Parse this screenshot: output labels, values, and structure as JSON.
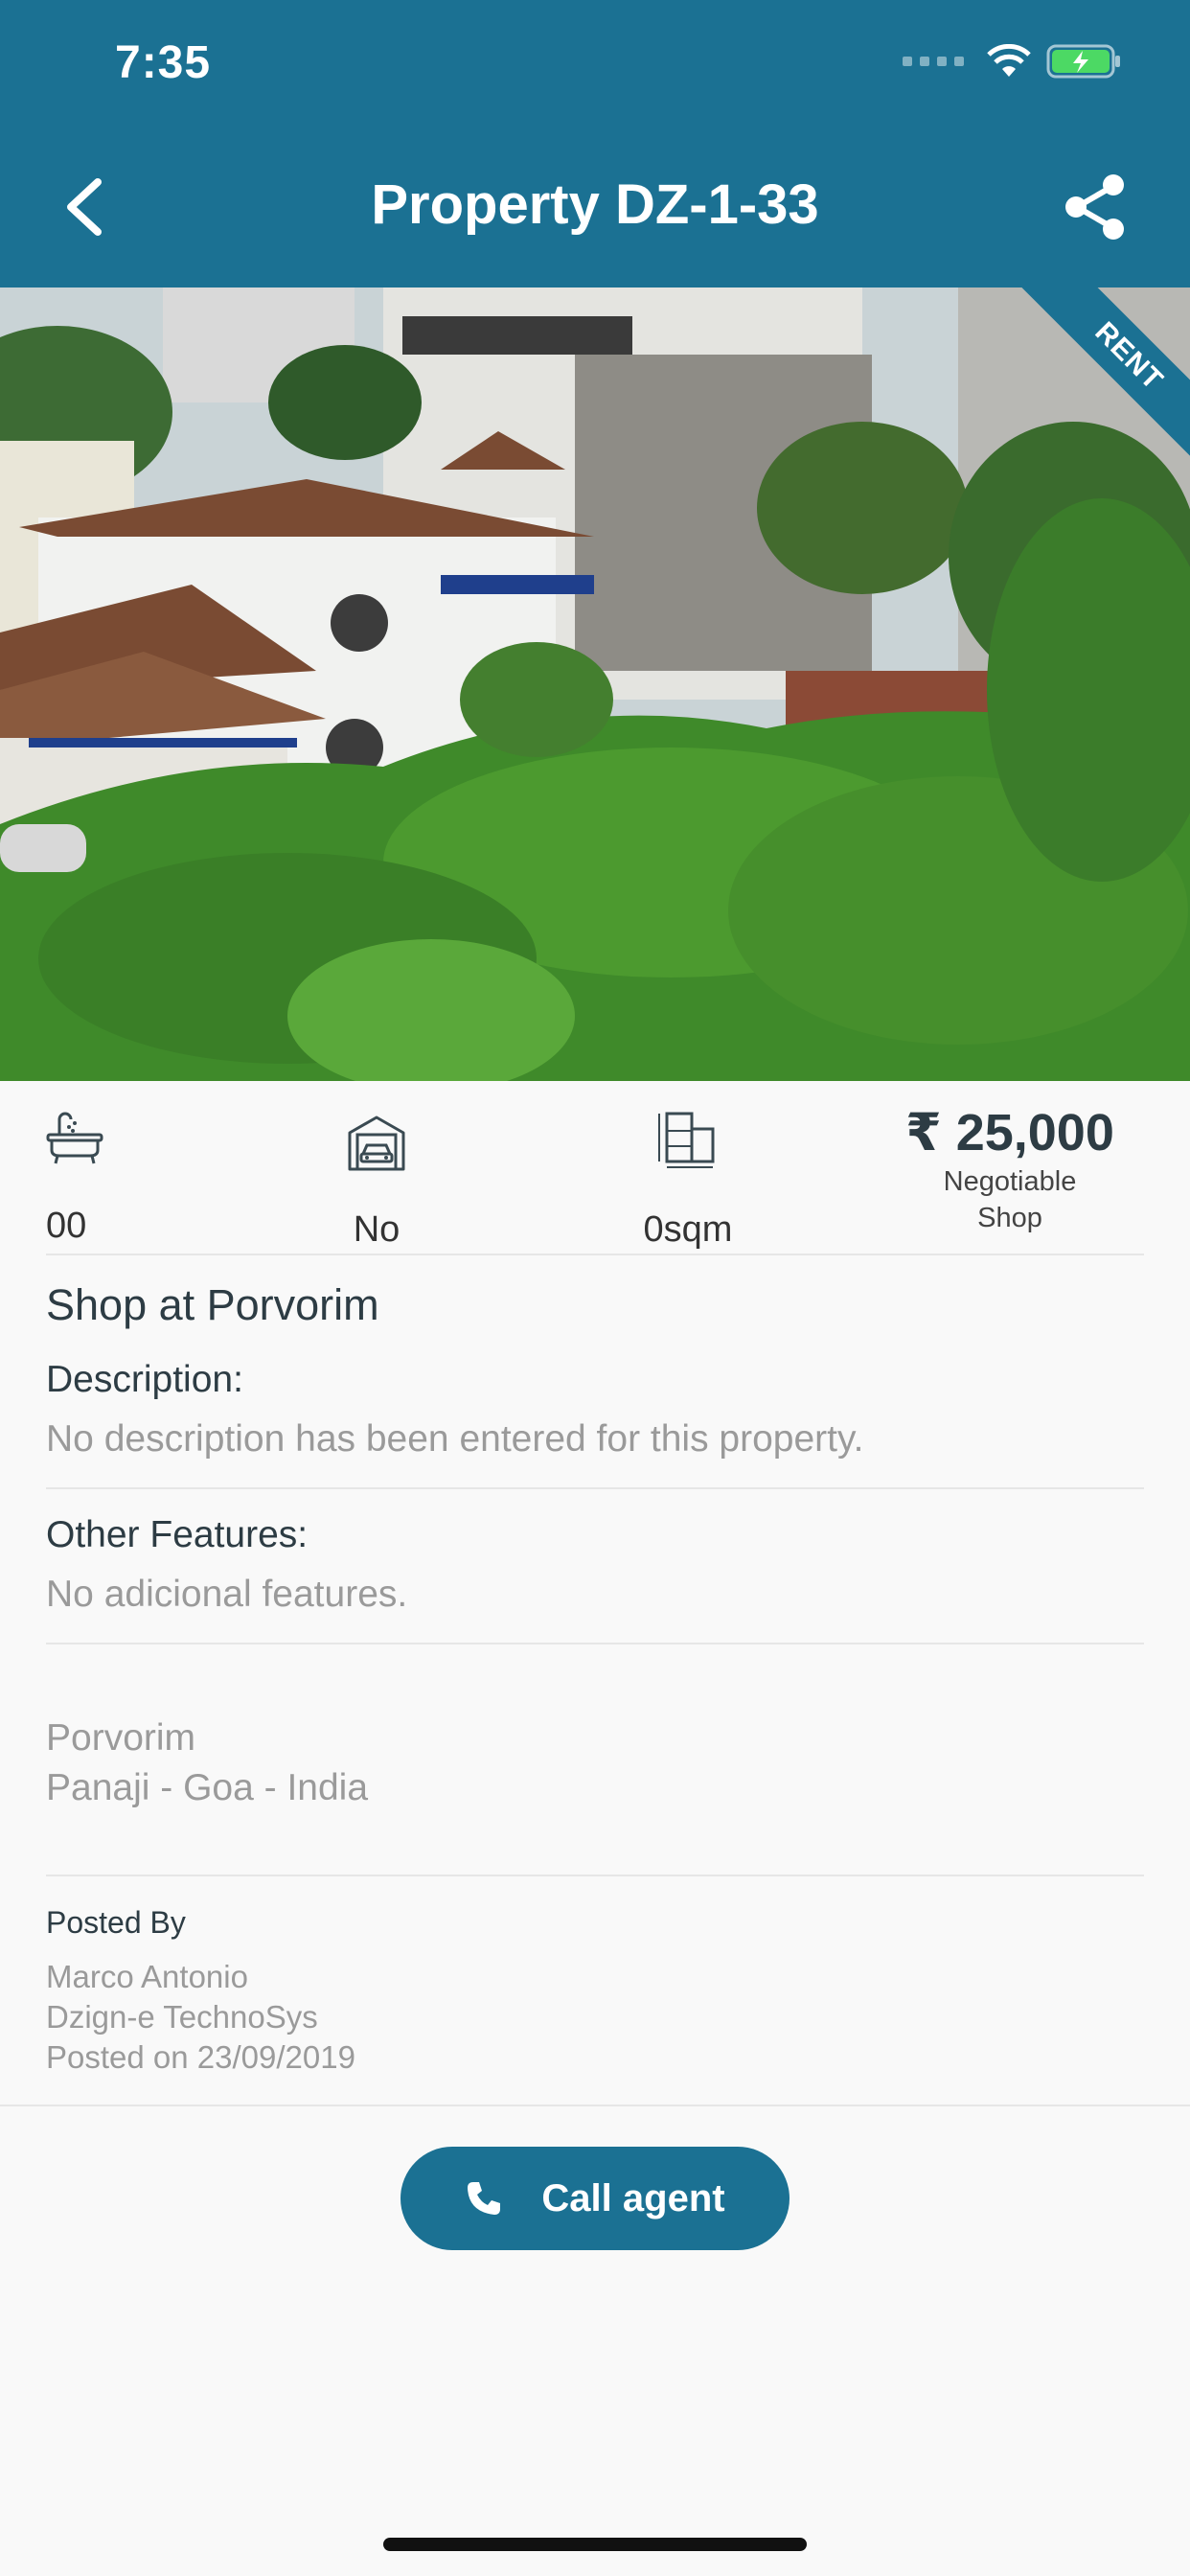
{
  "status_bar": {
    "time": "7:35",
    "wifi_icon": "wifi-icon",
    "battery_icon": "battery-charging-icon"
  },
  "header": {
    "title": "Property DZ-1-33",
    "back_icon": "chevron-left-icon",
    "share_icon": "share-icon",
    "background_color": "#1b7193"
  },
  "hero": {
    "badge": "RENT",
    "image_subject": "photo"
  },
  "stats": {
    "bathrooms": "00",
    "garage": "No",
    "area": "0sqm",
    "price": "₹ 25,000",
    "price_note": "Negotiable",
    "property_type": "Shop"
  },
  "details": {
    "title": "Shop at Porvorim",
    "description_label": "Description:",
    "description_text": "No description has been entered for this property.",
    "features_label": "Other Features:",
    "features_text": "No adicional features."
  },
  "location": {
    "line1": "Porvorim",
    "line2": "Panaji - Goa - India"
  },
  "posted": {
    "label": "Posted By",
    "agent": "Marco Antonio",
    "company": "Dzign-e TechnoSys",
    "date": "Posted on 23/09/2019"
  },
  "actions": {
    "call_label": "Call agent",
    "accent_color": "#1b7193"
  }
}
